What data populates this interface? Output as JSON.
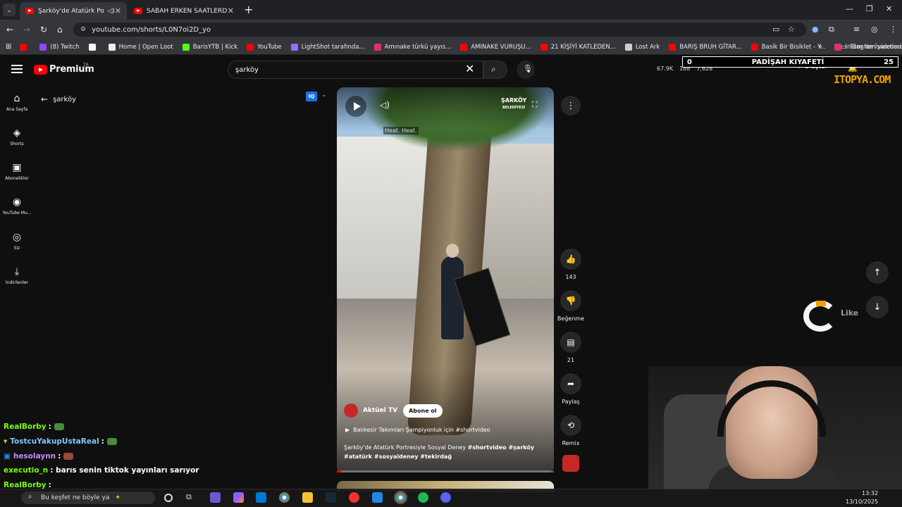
{
  "browser": {
    "tabs": [
      {
        "title": "Şarköy'de Atatürk Portresiyl",
        "active": true
      },
      {
        "title": "SABAH ERKEN SAATLERDE ŞAR",
        "active": false
      }
    ],
    "url": "youtube.com/shorts/L0N7oi2D_yo",
    "bookmarks": [
      {
        "label": "",
        "color": "#ff0000"
      },
      {
        "label": "(8) Twitch",
        "color": "#9146ff"
      },
      {
        "label": "",
        "color": "#ffffff"
      },
      {
        "label": "Home | Open Loot",
        "color": "#eeeeee"
      },
      {
        "label": "BarisYTB | Kick",
        "color": "#53fc18"
      },
      {
        "label": "YouTube",
        "color": "#ff0000"
      },
      {
        "label": "LightShot tarafında...",
        "color": "#9b6bff"
      },
      {
        "label": "Amınake türkü yayıs...",
        "color": "#e1306c"
      },
      {
        "label": "AMINAKE VURUŞU...",
        "color": "#ff0000"
      },
      {
        "label": "21 KİŞİYİ KATLEDEN...",
        "color": "#ff0000"
      },
      {
        "label": "Lost Ark",
        "color": "#cccccc"
      },
      {
        "label": "BARIŞ BRUH GİTAR...",
        "color": "#ff0000"
      },
      {
        "label": "Basik Bir Bisiklet - Y...",
        "color": "#ff0000"
      },
      {
        "label": "Instagram videosu:...",
        "color": "#e1306c"
      }
    ],
    "bookmarks_more": "»",
    "all_bookmarks": "Tüm Yer İşaretleri"
  },
  "youtube": {
    "logo_text": "Premium",
    "country_code": "TR",
    "search_value": "şarköy",
    "back_label": "şarköy",
    "sidebar": [
      {
        "label": "Ana Sayfa",
        "icon": "⌂"
      },
      {
        "label": "Shorts",
        "icon": "◈"
      },
      {
        "label": "Abonelikler",
        "icon": "▣"
      },
      {
        "label": "YouTube Mu...",
        "icon": "◉"
      },
      {
        "label": "Siz",
        "icon": "◎"
      },
      {
        "label": "İndirilenler",
        "icon": "⤓"
      }
    ],
    "video": {
      "watermark_line1": "ŞARKÖY",
      "watermark_line2": "BELEDİYESİ",
      "caption_overlay": "Heat. Heat.",
      "channel_name": "Aktüel TV",
      "subscribe_label": "Abone ol",
      "playlist": "Balıkesir Takımları Şampiyonluk için #shortvideo",
      "title": "Şarköy'de Atatürk Portresiyle Sosyal Deney",
      "hashtags": "#shortvideo #şarköy #atatürk #sosyaldeney #tekirdağ"
    },
    "actions": {
      "likes": "143",
      "dislike_label": "Beğenme",
      "comments": "21",
      "share_label": "Paylaş",
      "remix_label": "Remix"
    }
  },
  "stream_overlay": {
    "stats": [
      "67.9K",
      "188",
      "7,628"
    ],
    "create_label": "Oluştur",
    "banner_left": "0",
    "banner_title": "PADİŞAH KIYAFETİ",
    "banner_right": "25",
    "brand_tag": "ITOPYA.COM",
    "like_text": "Like"
  },
  "chat": [
    {
      "user": "RealBorby",
      "text": ":",
      "user_color": "#7cfc00"
    },
    {
      "user": "TostcuYakupUstaReal",
      "text": ":",
      "user_color": "#7ec8ff"
    },
    {
      "user": "hesolaynn",
      "text": ":",
      "user_color": "#c58cff"
    },
    {
      "user": "executio_n",
      "text": ": barıs senin tiktok yayınları sarıyor",
      "user_color": "#ffffff"
    },
    {
      "user": "RealBorby",
      "text": ":",
      "user_color": "#7cfc00"
    }
  ],
  "taskbar": {
    "search_text": "Bu keşfet ne böyle ya",
    "time": "13:32",
    "date": "13/10/2025"
  }
}
